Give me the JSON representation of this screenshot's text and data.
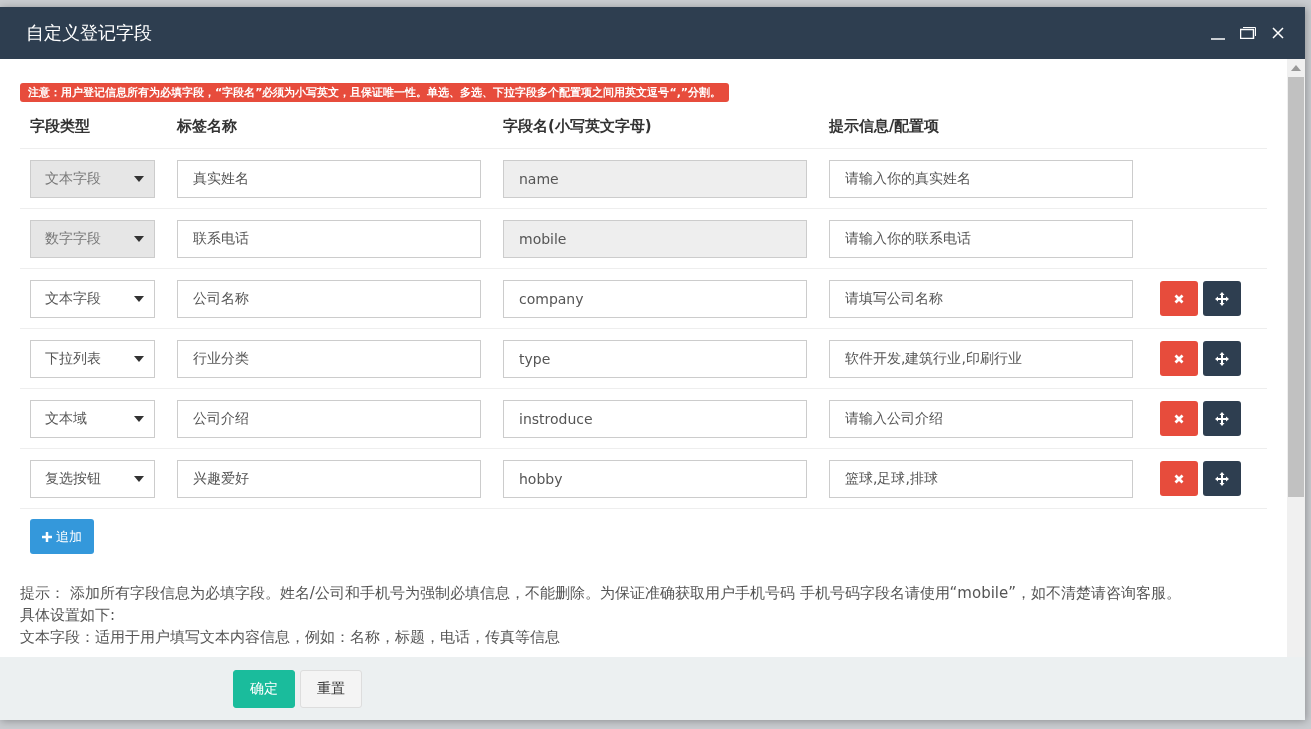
{
  "dialog": {
    "title": "自定义登记字段"
  },
  "notice": "注意：用户登记信息所有为必填字段，“字段名”必须为小写英文，且保证唯一性。单选、多选、下拉字段多个配置项之间用英文逗号“,”分割。",
  "columns": [
    "字段类型",
    "标签名称",
    "字段名(小写英文字母)",
    "提示信息/配置项"
  ],
  "rows": [
    {
      "type": "文本字段",
      "label": "真实姓名",
      "name": "name",
      "hint": "请输入你的真实姓名",
      "locked": true
    },
    {
      "type": "数字字段",
      "label": "联系电话",
      "name": "mobile",
      "hint": "请输入你的联系电话",
      "locked": true
    },
    {
      "type": "文本字段",
      "label": "公司名称",
      "name": "company",
      "hint": "请填写公司名称",
      "locked": false
    },
    {
      "type": "下拉列表",
      "label": "行业分类",
      "name": "type",
      "hint": "软件开发,建筑行业,印刷行业",
      "locked": false
    },
    {
      "type": "文本域",
      "label": "公司介绍",
      "name": "instroduce",
      "hint": "请输入公司介绍",
      "locked": false
    },
    {
      "type": "复选按钮",
      "label": "兴趣爱好",
      "name": "hobby",
      "hint": "篮球,足球,排球",
      "locked": false
    }
  ],
  "add_button": "追加",
  "notes": [
    "提示： 添加所有字段信息为必填字段。姓名/公司和手机号为强制必填信息，不能删除。为保证准确获取用户手机号码 手机号码字段名请使用“mobile”，如不清楚请咨询客服。",
    "具体设置如下:",
    "文本字段：适用于用户填写文本内容信息，例如：名称，标题，电话，传真等信息"
  ],
  "buttons": [
    {
      "label": "确定",
      "kind": "primary"
    },
    {
      "label": "重置",
      "kind": "default"
    }
  ]
}
